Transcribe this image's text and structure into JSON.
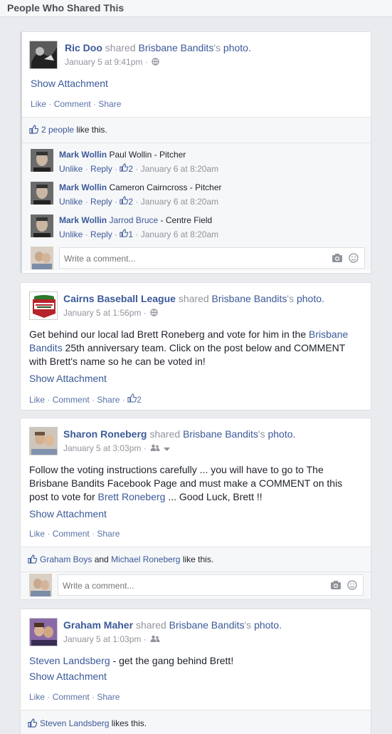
{
  "header": {
    "title": "People Who Shared This"
  },
  "colors": {
    "link": "#3b5998",
    "meta": "#90949c",
    "background": "#e9ebee"
  },
  "posts": [
    {
      "author": "Ric Doo",
      "verb": "shared",
      "source": "Brisbane Bandits",
      "source_suffix": "'s",
      "object": "photo.",
      "time": "January 5 at 9:41pm",
      "privacy_icon": "globe-icon",
      "show_attachment": "Show Attachment",
      "actions": {
        "like": "Like",
        "comment": "Comment",
        "share": "Share"
      },
      "likes": {
        "count_link": "2 people",
        "suffix": "like this."
      },
      "comments": [
        {
          "name": "Mark Wollin",
          "text": "Paul Wollin - Pitcher",
          "unlike": "Unlike",
          "reply": "Reply",
          "likes": "2",
          "time": "January 6 at 8:20am"
        },
        {
          "name": "Mark Wollin",
          "text": "Cameron Cairncross - Pitcher",
          "unlike": "Unlike",
          "reply": "Reply",
          "likes": "2",
          "time": "January 6 at 8:20am"
        },
        {
          "name": "Mark Wollin",
          "tag": "Jarrod Bruce",
          "text": "- Centre Field",
          "unlike": "Unlike",
          "reply": "Reply",
          "likes": "1",
          "time": "January 6 at 8:20am"
        }
      ],
      "comment_placeholder": "Write a comment..."
    },
    {
      "author": "Cairns Baseball League",
      "verb": "shared",
      "source": "Brisbane Bandits",
      "source_suffix": "'s",
      "object": "photo.",
      "time": "January 5 at 1:56pm",
      "privacy_icon": "globe-icon",
      "body_pre": "Get behind our local lad Brett Roneberg and vote for him in the ",
      "body_link": "Brisbane Bandits",
      "body_post": " 25th anniversary team. Click on the post below and COMMENT with Brett's name so he can be voted in!",
      "show_attachment": "Show Attachment",
      "actions": {
        "like": "Like",
        "comment": "Comment",
        "share": "Share",
        "likes": "2"
      }
    },
    {
      "author": "Sharon Roneberg",
      "verb": "shared",
      "source": "Brisbane Bandits",
      "source_suffix": "'s",
      "object": "photo.",
      "time": "January 5 at 3:03pm",
      "privacy_icon": "friends-icon",
      "body_pre": "Follow the voting instructions carefully ... you will have to go to The Brisbane Bandits Facebook Page and must make a COMMENT on this post to vote for ",
      "body_link": "Brett Roneberg",
      "body_post": " ... Good Luck, Brett !!",
      "show_attachment": "Show Attachment",
      "actions": {
        "like": "Like",
        "comment": "Comment",
        "share": "Share"
      },
      "likes": {
        "person1": "Graham Boys",
        "and": "and",
        "person2": "Michael Roneberg",
        "suffix": "like this."
      },
      "comment_placeholder": "Write a comment..."
    },
    {
      "author": "Graham Maher",
      "verb": "shared",
      "source": "Brisbane Bandits",
      "source_suffix": "'s",
      "object": "photo.",
      "time": "January 5 at 1:03pm",
      "privacy_icon": "friends-icon",
      "body_link": "Steven Landsberg",
      "body_post": " - get the gang behind Brett!",
      "show_attachment": "Show Attachment",
      "actions": {
        "like": "Like",
        "comment": "Comment",
        "share": "Share"
      },
      "likes": {
        "person1": "Steven Landsberg",
        "suffix": "likes this."
      }
    }
  ]
}
